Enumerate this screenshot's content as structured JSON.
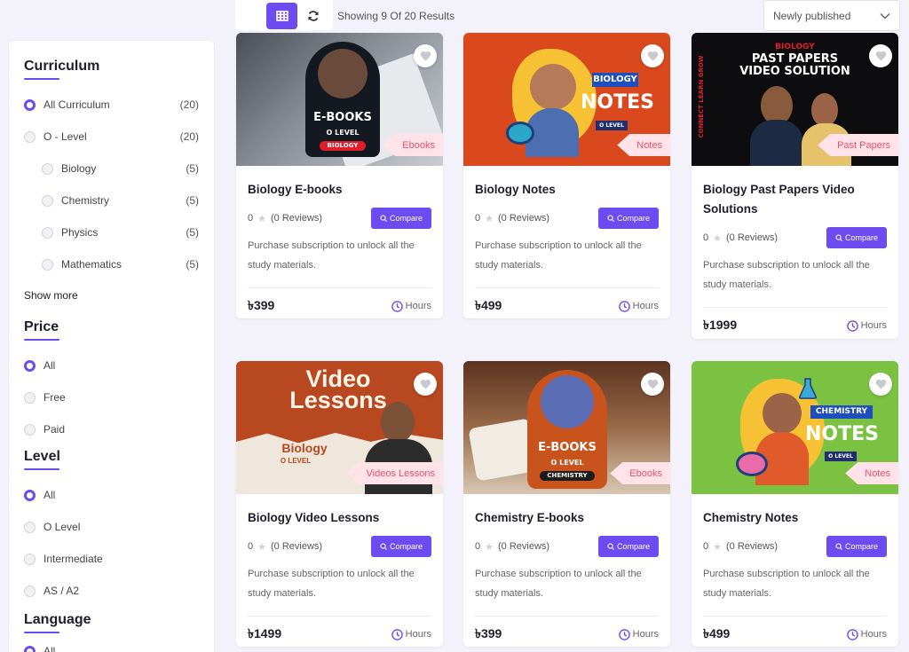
{
  "toolbar": {
    "result_text": "Showing 9 Of 20 Results",
    "sort_value": "Newly published"
  },
  "filters": {
    "curriculum": {
      "title": "Curriculum",
      "options": [
        {
          "label": "All Curriculum",
          "count": "(20)"
        },
        {
          "label": "O - Level",
          "count": "(20)"
        },
        {
          "label": "Biology",
          "count": "(5)"
        },
        {
          "label": "Chemistry",
          "count": "(5)"
        },
        {
          "label": "Physics",
          "count": "(5)"
        },
        {
          "label": "Mathematics",
          "count": "(5)"
        }
      ],
      "show_more": "Show more"
    },
    "price": {
      "title": "Price",
      "options": [
        "All",
        "Free",
        "Paid"
      ]
    },
    "level": {
      "title": "Level",
      "options": [
        "All",
        "O Level",
        "Intermediate",
        "AS / A2"
      ]
    },
    "language": {
      "title": "Language",
      "options": [
        "All"
      ]
    }
  },
  "common": {
    "compare": "Compare",
    "rating": "0",
    "reviews": "(0 Reviews)",
    "desc": "Purchase subscription to unlock all the study materials.",
    "hours": "Hours"
  },
  "cards": [
    {
      "title": "Biology E-books",
      "tag": "Ebooks",
      "price": "৳399",
      "art": {
        "main": "E-BOOKS",
        "sub": "O LEVEL",
        "pill": "BIOLOGY"
      }
    },
    {
      "title": "Biology Notes",
      "tag": "Notes",
      "price": "৳499",
      "art": {
        "main": "NOTES",
        "sub": "BIOLOGY",
        "pill": "O LEVEL"
      }
    },
    {
      "title": "Biology Past Papers Video Solutions",
      "tag": "Past Papers",
      "price": "৳1999",
      "art": {
        "top": "BIOLOGY",
        "main": "PAST PAPERS",
        "sub": "VIDEO SOLUTION",
        "side_left": "CONNECT LEARN GROW",
        "side_right": "CONNECT LEARN G"
      }
    },
    {
      "title": "Biology Video Lessons",
      "tag": "Videos Lessons",
      "price": "৳1499",
      "art": {
        "main1": "Video",
        "main2": "Lessons",
        "sub": "Biology",
        "pill": "O LEVEL"
      }
    },
    {
      "title": "Chemistry E-books",
      "tag": "Ebooks",
      "price": "৳399",
      "art": {
        "main": "E-BOOKS",
        "sub": "O LEVEL",
        "pill": "CHEMISTRY"
      }
    },
    {
      "title": "Chemistry Notes",
      "tag": "Notes",
      "price": "৳499",
      "art": {
        "main": "NOTES",
        "sub": "CHEMISTRY",
        "pill": "O LEVEL"
      }
    }
  ],
  "colors": {
    "accent": "#6c4cf0",
    "tag_bg": "#ffe3e8",
    "tag_text": "#ef4e6b"
  }
}
